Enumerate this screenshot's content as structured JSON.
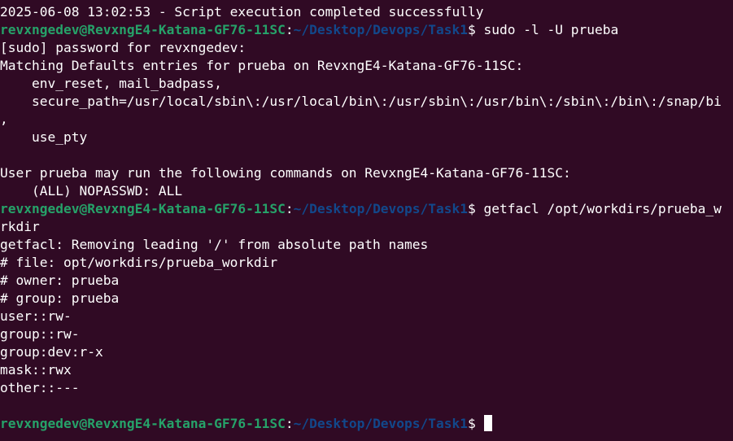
{
  "colors": {
    "background": "#300a24",
    "foreground": "#ffffff",
    "prompt_user": "#26a269",
    "prompt_path": "#12488b",
    "cursor": "#ffffff"
  },
  "terminal": {
    "lines": [
      {
        "type": "text",
        "text": "2025-06-08 13:02:53 - Script execution completed successfully"
      },
      {
        "type": "prompt",
        "user": "revxngedev@RevxngE4-Katana-GF76-11SC",
        "sep": ":",
        "path": "~/Desktop/Devops/Task1",
        "cmd": "$ sudo -l -U prueba"
      },
      {
        "type": "text",
        "text": "[sudo] password for revxngedev:"
      },
      {
        "type": "text",
        "text": "Matching Defaults entries for prueba on RevxngE4-Katana-GF76-11SC:"
      },
      {
        "type": "text",
        "text": "    env_reset, mail_badpass,"
      },
      {
        "type": "text",
        "text": "    secure_path=/usr/local/sbin\\:/usr/local/bin\\:/usr/sbin\\:/usr/bin\\:/sbin\\:/bin\\:/snap/bi"
      },
      {
        "type": "text",
        "text": ","
      },
      {
        "type": "text",
        "text": "    use_pty"
      },
      {
        "type": "text",
        "text": ""
      },
      {
        "type": "text",
        "text": "User prueba may run the following commands on RevxngE4-Katana-GF76-11SC:"
      },
      {
        "type": "text",
        "text": "    (ALL) NOPASSWD: ALL"
      },
      {
        "type": "prompt",
        "user": "revxngedev@RevxngE4-Katana-GF76-11SC",
        "sep": ":",
        "path": "~/Desktop/Devops/Task1",
        "cmd": "$ getfacl /opt/workdirs/prueba_w"
      },
      {
        "type": "text",
        "text": "rkdir"
      },
      {
        "type": "text",
        "text": "getfacl: Removing leading '/' from absolute path names"
      },
      {
        "type": "text",
        "text": "# file: opt/workdirs/prueba_workdir"
      },
      {
        "type": "text",
        "text": "# owner: prueba"
      },
      {
        "type": "text",
        "text": "# group: prueba"
      },
      {
        "type": "text",
        "text": "user::rw-"
      },
      {
        "type": "text",
        "text": "group::rw-"
      },
      {
        "type": "text",
        "text": "group:dev:r-x"
      },
      {
        "type": "text",
        "text": "mask::rwx"
      },
      {
        "type": "text",
        "text": "other::---"
      },
      {
        "type": "text",
        "text": ""
      },
      {
        "type": "prompt",
        "user": "revxngedev@RevxngE4-Katana-GF76-11SC",
        "sep": ":",
        "path": "~/Desktop/Devops/Task1",
        "cmd": "$ ",
        "cursor": true
      }
    ]
  }
}
